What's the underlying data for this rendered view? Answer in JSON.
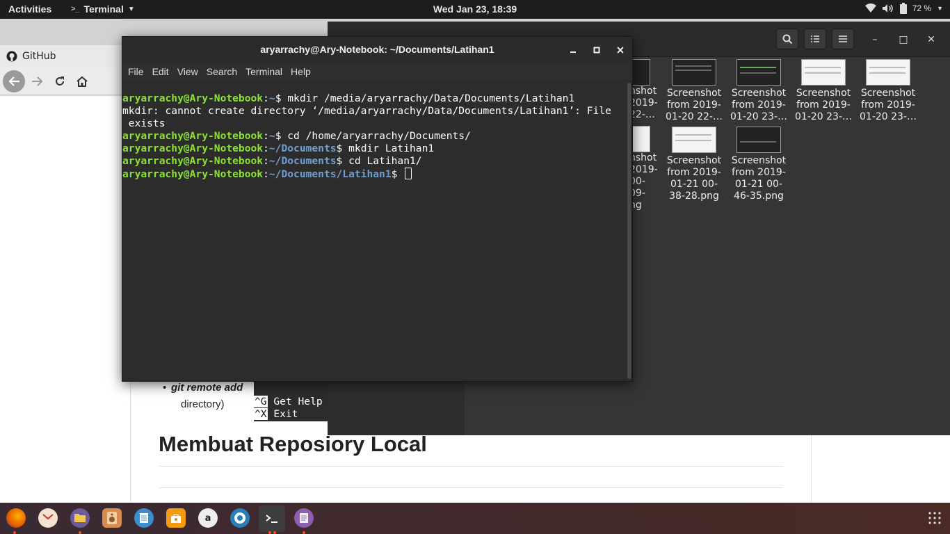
{
  "topbar": {
    "activities": "Activities",
    "app_name": "Terminal",
    "clock": "Wed Jan 23, 18:39",
    "battery": "72 %"
  },
  "browser": {
    "tab_title": "GitHub",
    "bullet_text": "git remote add",
    "bullet_cont": "directory)",
    "heading": "Membuat Reposiory Local"
  },
  "files": {
    "items": [
      {
        "label": "Screenshot from 2019-01-20 22-…"
      },
      {
        "label": "Screenshot from 2019-01-20 23-…"
      },
      {
        "label": "Screenshot from 2019-01-20 23-…"
      },
      {
        "label": "Screenshot from 2019-01-20 23-…"
      },
      {
        "label": "Screenshot from 2019-01-21 00-38-28.png"
      },
      {
        "label": "Screenshot from 2019-01-21 00-46-35.png"
      }
    ],
    "partial_col1": "nshot 2019- 22-…",
    "partial_col2": "nshot 2019- 00-09- ng"
  },
  "terminal": {
    "title": "aryarrachy@Ary-Notebook: ~/Documents/Latihan1",
    "menu": [
      "File",
      "Edit",
      "View",
      "Search",
      "Terminal",
      "Help"
    ],
    "user": "aryarrachy@Ary-Notebook",
    "lines": [
      {
        "path": "~",
        "cmd": " mkdir /media/aryarrachy/Data/Documents/Latihan1"
      },
      {
        "output": "mkdir: cannot create directory ‘/media/aryarrachy/Data/Documents/Latihan1’: File"
      },
      {
        "output": " exists"
      },
      {
        "path": "~",
        "cmd": " cd /home/aryarrachy/Documents/"
      },
      {
        "path": "~/Documents",
        "cmd": " mkdir Latihan1"
      },
      {
        "path": "~/Documents",
        "cmd": " cd Latihan1/"
      },
      {
        "path": "~/Documents/Latihan1",
        "cmd": " "
      }
    ]
  },
  "nano": {
    "k1": "^G",
    "l1": " Get Help",
    "k2": "^X",
    "l2": " Exit"
  },
  "dock": {
    "apps": [
      "firefox-icon",
      "mail-icon",
      "files-icon",
      "music-icon",
      "text-editor-icon",
      "software-icon",
      "amazon-icon",
      "help-icon",
      "terminal-icon",
      "notes-icon"
    ],
    "amazon_letter": "a"
  }
}
